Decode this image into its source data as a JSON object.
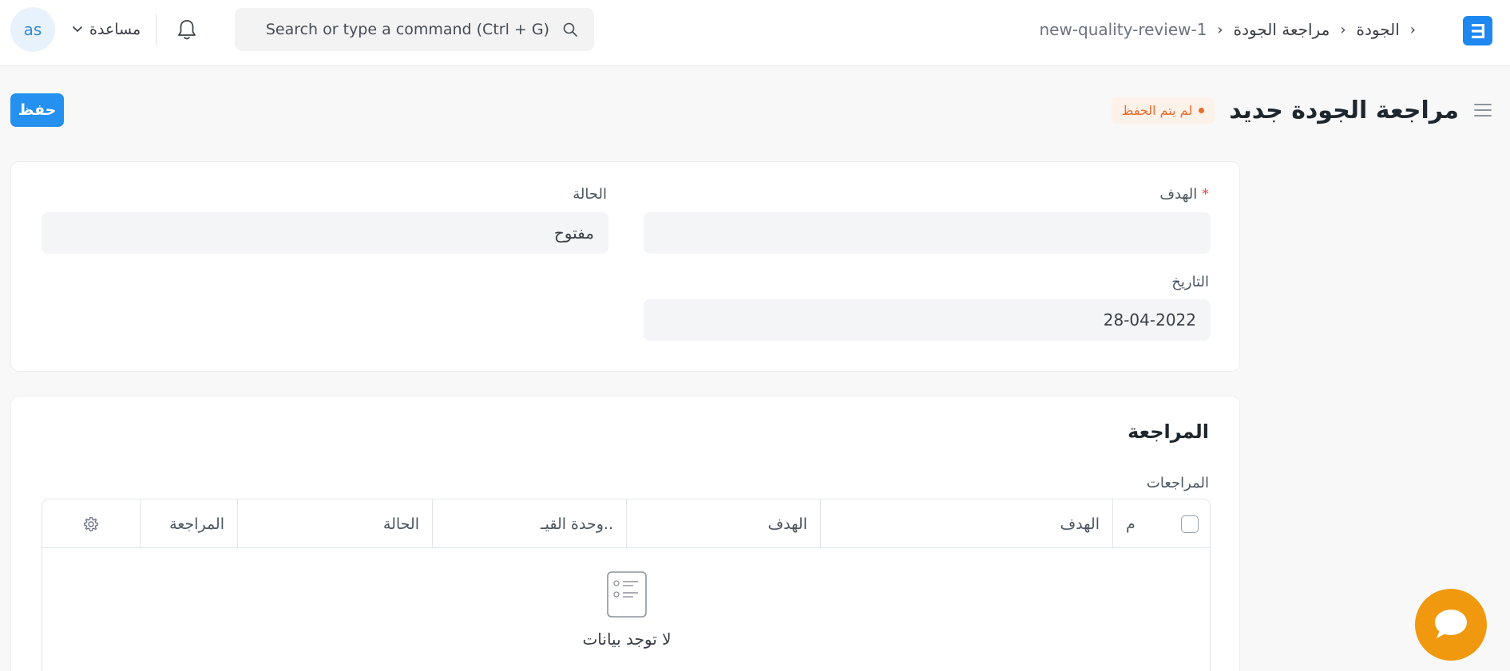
{
  "navbar": {
    "logo_letter": "E",
    "breadcrumbs": [
      "الجودة",
      "مراجعة الجودة",
      "new-quality-review-1"
    ],
    "search_placeholder": "Search or type a command (Ctrl + G)",
    "help_label": "مساعدة",
    "avatar_initials": "as"
  },
  "page": {
    "title": "مراجعة الجودة جديد",
    "status_badge": "لم يتم الحفظ",
    "save_label": "حفظ"
  },
  "form": {
    "goal_label": "الهدف",
    "goal_required_mark": "*",
    "goal_value": "",
    "status_label": "الحالة",
    "status_value": "مفتوح",
    "date_label": "التاريخ",
    "date_value": "28-04-2022"
  },
  "reviews_section": {
    "title": "المراجعة",
    "table_label": "المراجعات",
    "columns": [
      "م",
      "الهدف",
      "الهدف",
      "وحدة القيـ..",
      "الحالة",
      "المراجعة"
    ],
    "empty_text": "لا توجد بيانات"
  },
  "colors": {
    "primary": "#2490ef",
    "unsaved": "#e86c2b",
    "chat": "#f0990f"
  }
}
